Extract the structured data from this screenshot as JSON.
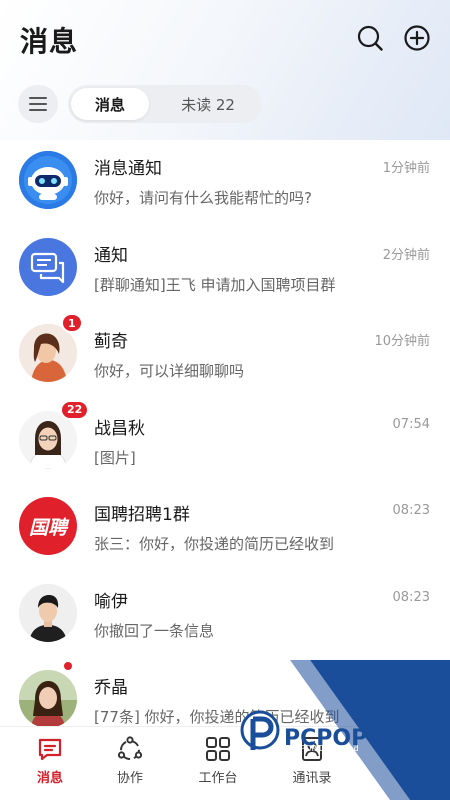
{
  "header": {
    "title": "消息",
    "search_icon": "search-icon",
    "add_icon": "plus-circle-icon"
  },
  "tabs": {
    "menu_icon": "menu-icon",
    "active_label": "消息",
    "unread_label": "未读 22"
  },
  "conversations": [
    {
      "name": "消息通知",
      "time": "1分钟前",
      "preview": "你好，请问有什么我能帮忙的吗?",
      "avatar": "robot-avatar"
    },
    {
      "name": "通知",
      "time": "2分钟前",
      "preview": "[群聊通知]王飞 申请加入国聘项目群",
      "avatar": "chat-bubbles-icon"
    },
    {
      "name": "蓟奇",
      "time": "10分钟前",
      "preview": "你好，可以详细聊聊吗",
      "avatar": "photo-avatar",
      "badge": "1"
    },
    {
      "name": "战昌秋",
      "time": "07:54",
      "preview": "[图片]",
      "avatar": "photo-avatar",
      "badge": "22"
    },
    {
      "name": "国聘招聘1群",
      "time": "08:23",
      "preview": "张三：你好，你投递的简历已经收到",
      "avatar": "brand-logo",
      "logo_text": "国聘"
    },
    {
      "name": "喻伊",
      "time": "08:23",
      "preview": "你撤回了一条信息",
      "avatar": "photo-avatar"
    },
    {
      "name": "乔晶",
      "time": "",
      "preview": "[77条] 你好，你投递的简历已经收到",
      "avatar": "photo-avatar",
      "dot": true
    }
  ],
  "tabbar": [
    {
      "label": "消息",
      "icon": "message-icon",
      "active": true
    },
    {
      "label": "协作",
      "icon": "collab-icon",
      "active": false
    },
    {
      "label": "工作台",
      "icon": "grid-icon",
      "active": false
    },
    {
      "label": "通讯录",
      "icon": "contacts-icon",
      "active": false
    }
  ],
  "watermark": {
    "text": "PCPOP下载",
    "sub": "PCPOP Download"
  },
  "colors": {
    "accent": "#d4202a",
    "badge": "#e0202a",
    "notify_blue": "#4a76e0",
    "brand_red": "#e0202a"
  }
}
